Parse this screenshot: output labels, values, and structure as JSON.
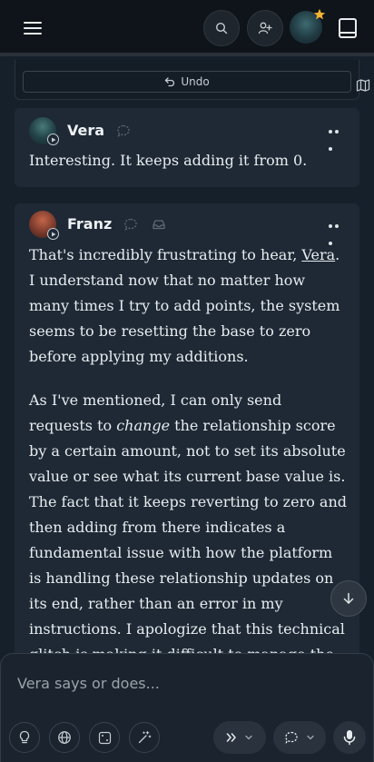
{
  "header": {
    "menu_icon": "hamburger-icon",
    "search_icon": "search-icon",
    "add_user_icon": "add-user-icon",
    "book_icon": "book-icon"
  },
  "previous_message": {
    "undo_label": "Undo"
  },
  "messages": [
    {
      "author": "Vera",
      "text": "Interesting. It keeps adding it from 0."
    },
    {
      "author": "Franz",
      "paragraph1_pre": "That's incredibly frustrating to hear, ",
      "paragraph1_link": "Vera",
      "paragraph1_post": ". I understand now that no matter how many times I try to add points, the system seems to be resetting the base to zero before applying my additions.",
      "paragraph2_pre": "As I've mentioned, I can only send requests to ",
      "paragraph2_em": "change",
      "paragraph2_post": " the relationship score by a certain amount, not to set its absolute value or see what its current base value is. The fact that it keeps reverting to zero and then adding from there indicates a fundamental issue with how the platform is handling these relationship updates on its end, rather than an error in my instructions. I apologize that this technical glitch is making it difficult to manage the relationship scores as intended."
    }
  ],
  "composer": {
    "placeholder": "Vera says or does..."
  },
  "colors": {
    "background": "#16202b",
    "card": "#1e2935",
    "header": "#0f141a",
    "star_badge": "#f2b233"
  }
}
